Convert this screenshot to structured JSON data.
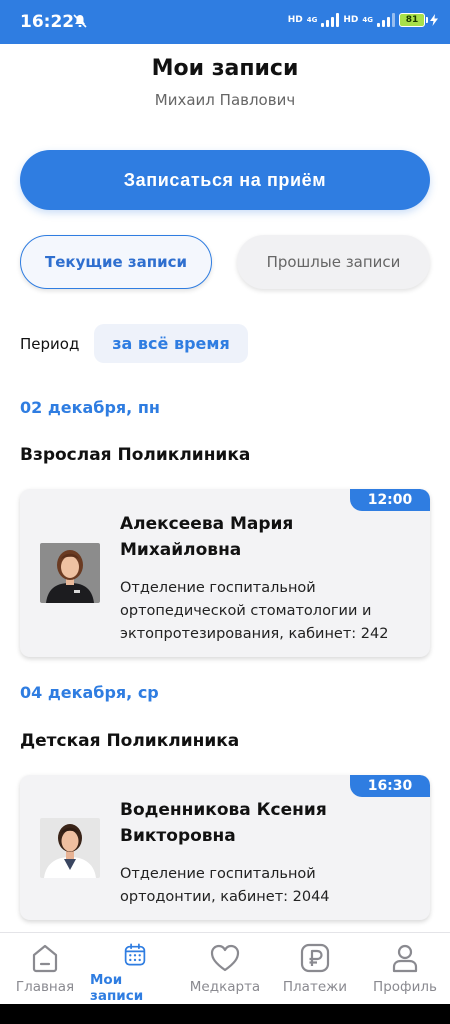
{
  "status_bar": {
    "time": "16:22",
    "net1": "HD",
    "net1_gen": "4G",
    "net2": "HD",
    "net2_gen": "4G",
    "battery": "81",
    "icons": [
      "mute-icon",
      "signal-icon",
      "signal-icon",
      "battery-charging-icon"
    ]
  },
  "header": {
    "title": "Мои записи",
    "subtitle": "Михаил Павлович"
  },
  "book_button": {
    "label": "Записаться на приём"
  },
  "tabs": [
    {
      "label": "Текущие записи",
      "active": true
    },
    {
      "label": "Прошлые записи",
      "active": false
    }
  ],
  "period": {
    "label": "Период",
    "value": "за всё время"
  },
  "appointments": [
    {
      "date": "02 декабря, пн",
      "clinic": "Взрослая Поликлиника",
      "time": "12:00",
      "doctor_line1": "Алексеева Мария",
      "doctor_line2": "Михайловна",
      "dept_line1": "Отделение госпитальной",
      "dept_line2": "ортопедической стоматологии и",
      "dept_line3": "эктопротезирования, кабинет: 242"
    },
    {
      "date": "04 декабря, ср",
      "clinic": "Детская Поликлиника",
      "time": "16:30",
      "doctor_line1": "Воденникова Ксения",
      "doctor_line2": "Викторовна",
      "dept_line1": "Отделение госпитальной",
      "dept_line2": "ортодонтии, кабинет: 2044"
    }
  ],
  "bottom_nav": [
    {
      "label": "Главная",
      "icon": "home-icon",
      "active": false
    },
    {
      "label": "Мои записи",
      "icon": "calendar-icon",
      "active": true
    },
    {
      "label": "Медкарта",
      "icon": "heart-icon",
      "active": false
    },
    {
      "label": "Платежи",
      "icon": "ruble-icon",
      "active": false
    },
    {
      "label": "Профиль",
      "icon": "profile-icon",
      "active": false
    }
  ],
  "colors": {
    "accent": "#2f7de1",
    "text": "#111111",
    "muted": "#8a8a90",
    "card_bg": "#f3f3f5"
  }
}
